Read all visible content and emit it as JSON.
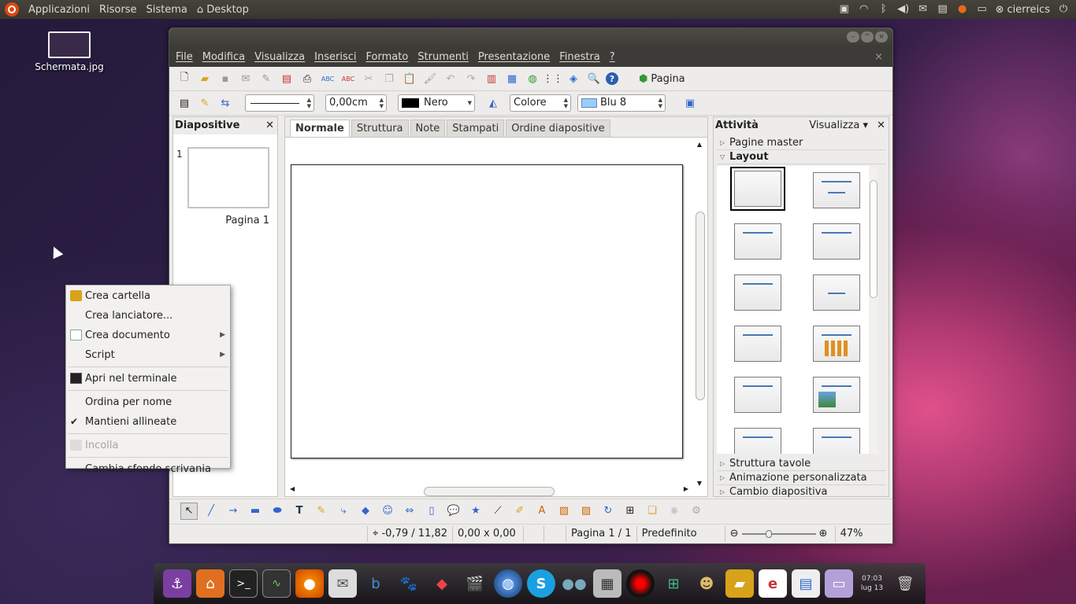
{
  "topbar": {
    "menus": [
      "Applicazioni",
      "Risorse",
      "Sistema",
      "Desktop"
    ],
    "user": "cierreics",
    "icons": [
      "clipboard-icon",
      "wifi-icon",
      "bluetooth-icon",
      "volume-icon",
      "mail-icon",
      "panel-icon",
      "firefox-icon",
      "window-icon",
      "user-icon",
      "power-icon"
    ]
  },
  "desktop": {
    "file_label": "Schermata.jpg"
  },
  "context_menu": {
    "items": [
      {
        "label": "Crea cartella",
        "icon": "folder-new-icon"
      },
      {
        "label": "Crea lanciatore..."
      },
      {
        "label": "Crea documento",
        "submenu": true,
        "icon": "document-new-icon"
      },
      {
        "label": "Script",
        "submenu": true
      },
      {
        "label": "Apri nel terminale",
        "icon": "terminal-icon"
      },
      {
        "label": "Ordina per nome"
      },
      {
        "label": "Mantieni allineate",
        "checked": true
      },
      {
        "label": "Incolla",
        "disabled": true,
        "icon": "paste-icon"
      },
      {
        "label": "Cambia sfondo scrivania"
      }
    ]
  },
  "window": {
    "menubar": [
      "File",
      "Modifica",
      "Visualizza",
      "Inserisci",
      "Formato",
      "Strumenti",
      "Presentazione",
      "Finestra",
      "?"
    ],
    "toolbar": {
      "page_label": "Pagina"
    },
    "format_bar": {
      "line_width": "0,00cm",
      "line_color": "Nero",
      "fill_type": "Colore",
      "fill_color": "Blu 8",
      "line_color_hex": "#000000",
      "fill_color_hex": "#99ccff"
    },
    "slides_pane": {
      "title": "Diapositive",
      "slide_number": "1",
      "slide_label": "Pagina 1"
    },
    "tabs": [
      "Normale",
      "Struttura",
      "Note",
      "Stampati",
      "Ordine diapositive"
    ],
    "tasks_pane": {
      "title": "Attività",
      "view_label": "Visualizza",
      "sections_top": [
        "Pagine master",
        "Layout"
      ],
      "sections_bottom": [
        "Struttura tavole",
        "Animazione personalizzata",
        "Cambio diapositiva"
      ]
    },
    "status": {
      "position": "-0,79 / 11,82",
      "size": "0,00 x 0,00",
      "page": "Pagina 1 / 1",
      "master": "Predefinito",
      "zoom": "47%"
    }
  },
  "dock": {
    "time": "07:03",
    "date": "lug 13"
  }
}
